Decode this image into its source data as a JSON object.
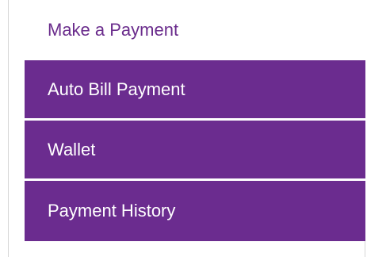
{
  "menu": {
    "items": [
      {
        "label": "Make a Payment",
        "state": "inactive"
      },
      {
        "label": "Auto Bill Payment",
        "state": "active"
      },
      {
        "label": "Wallet",
        "state": "active"
      },
      {
        "label": "Payment History",
        "state": "active"
      }
    ]
  },
  "colors": {
    "accent": "#6b2c8f",
    "inactive_text": "#6a2c8c",
    "active_text": "#ffffff"
  }
}
